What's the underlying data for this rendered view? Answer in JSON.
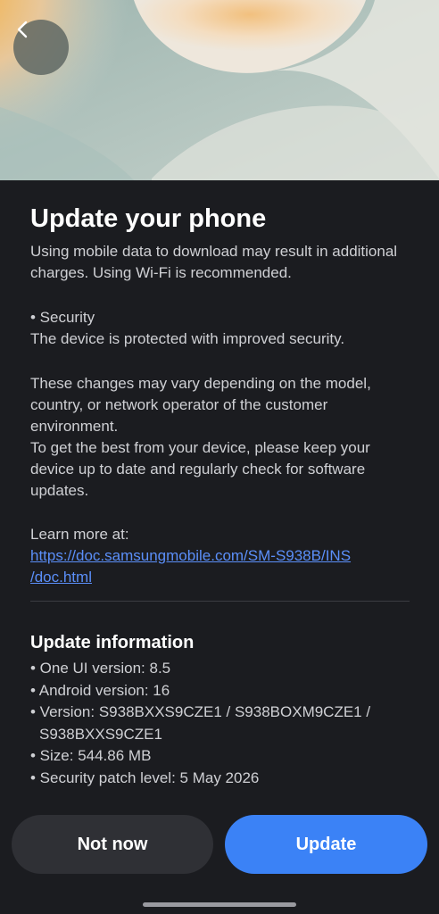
{
  "page": {
    "title": "Update your phone",
    "subtitle": "Using mobile data to download may result in additional charges. Using Wi-Fi is recommended."
  },
  "details": {
    "security_heading": "• Security",
    "security_text": "The device is protected with improved security.",
    "changes_text": "These changes may vary depending on the model, country, or network operator of the customer environment.",
    "keep_updated_text": "To get the best from your device, please keep your device up to date and regularly check for software updates.",
    "learn_more_label": "Learn more at:",
    "learn_more_url_line1": "https://doc.samsungmobile.com/SM-S938B/INS",
    "learn_more_url_line2": "/doc.html"
  },
  "update_info": {
    "heading": "Update information",
    "one_ui": "• One UI version: 8.5",
    "android": "• Android version: 16",
    "version_line1": "• Version: S938BXXS9CZE1 / S938BOXM9CZE1 /",
    "version_line2": "S938BXXS9CZE1",
    "size": "• Size: 544.86 MB",
    "security_patch": "• Security patch level: 5 May 2026"
  },
  "buttons": {
    "not_now": "Not now",
    "update": "Update"
  },
  "colors": {
    "background": "#1b1c20",
    "accent": "#3b82f6",
    "link": "#5b8ff9",
    "secondary_button": "#2f3035"
  },
  "icons": {
    "back": "chevron-left-icon"
  }
}
